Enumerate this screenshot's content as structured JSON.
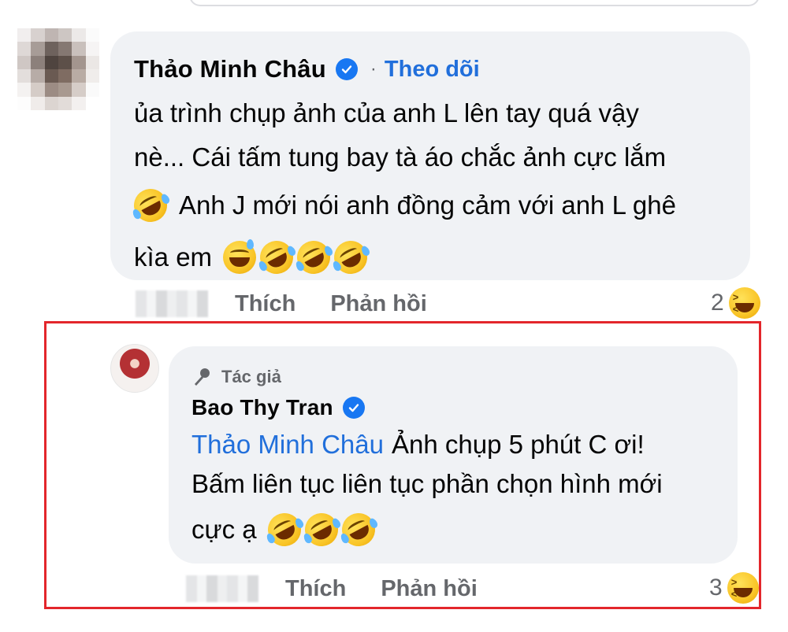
{
  "comment1": {
    "author": "Thảo Minh Châu",
    "follow_label": "Theo dõi",
    "separator": "·",
    "lines": [
      "ủa trình chụp ảnh của anh L lên tay quá vậy",
      "nè... Cái tấm tung bay tà áo chắc ảnh cực lắm",
      "Anh J mới nói anh đồng cảm với anh L ghê",
      "kìa em"
    ],
    "like_label": "Thích",
    "reply_label": "Phản hồi",
    "reaction_count": "2"
  },
  "reply": {
    "author_badge_label": "Tác giả",
    "author": "Bao Thy Tran",
    "mention": "Thảo Minh Châu",
    "lines": [
      "Ảnh chụp 5 phút C ơi!",
      "Bấm liên tục liên tục phần chọn hình mới",
      "cực ạ"
    ],
    "like_label": "Thích",
    "reply_label": "Phản hồi",
    "reaction_count": "3"
  },
  "colors": {
    "bubble": "#f0f2f5",
    "link_blue": "#216fdb",
    "verified_blue": "#1877f2",
    "muted": "#65676b",
    "highlight_red": "#e3262b"
  },
  "icons": {
    "verified": "verified-check-icon",
    "author_badge": "microphone-icon",
    "reaction": "laughing-face-icon",
    "emoji_rofl": "rolling-on-floor-laughing-emoji",
    "emoji_sweat": "grinning-sweat-emoji"
  }
}
